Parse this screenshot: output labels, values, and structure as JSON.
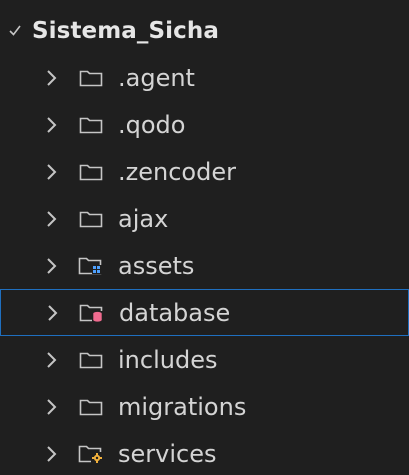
{
  "explorer": {
    "root": {
      "label": "Sistema_Sicha",
      "expanded": true
    },
    "items": [
      {
        "label": ".agent",
        "icon": "folder-icon"
      },
      {
        "label": ".qodo",
        "icon": "folder-icon"
      },
      {
        "label": ".zencoder",
        "icon": "folder-icon"
      },
      {
        "label": "ajax",
        "icon": "folder-icon"
      },
      {
        "label": "assets",
        "icon": "folder-assets-icon"
      },
      {
        "label": "database",
        "icon": "folder-database-icon",
        "focused": true
      },
      {
        "label": "includes",
        "icon": "folder-icon"
      },
      {
        "label": "migrations",
        "icon": "folder-icon"
      },
      {
        "label": "services",
        "icon": "folder-services-icon"
      }
    ]
  },
  "colors": {
    "background": "#1f1f1f",
    "focus_border": "#1f6fbf",
    "assets_badge": "#4ea1ff",
    "database_badge": "#f06b8f",
    "services_badge": "#f2b13c"
  }
}
